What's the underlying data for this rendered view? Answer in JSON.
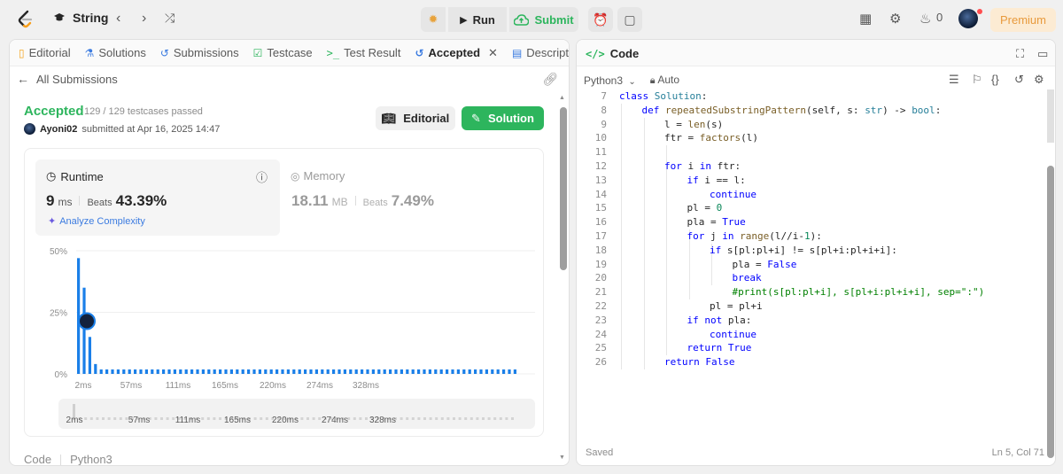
{
  "topbar": {
    "problem_title": "String",
    "run_label": "Run",
    "submit_label": "Submit",
    "streak_count": "0",
    "premium_label": "Premium"
  },
  "left_tabs": [
    {
      "label": "Editorial"
    },
    {
      "label": "Solutions"
    },
    {
      "label": "Submissions"
    },
    {
      "label": "Testcase"
    },
    {
      "label": "Test Result"
    },
    {
      "label": "Accepted"
    },
    {
      "label": "Description"
    }
  ],
  "submission": {
    "back_label": "All Submissions",
    "status": "Accepted",
    "testcases": "129 / 129 testcases passed",
    "user": "Ayoni02",
    "submitted_at": "submitted at Apr 16, 2025 14:47",
    "editorial_button": "Editorial",
    "solution_button": "Solution",
    "runtime_label": "Runtime",
    "runtime_value": "9",
    "runtime_unit": "ms",
    "runtime_beats_label": "Beats",
    "runtime_beats": "43.39%",
    "analyze_label": "Analyze Complexity",
    "memory_label": "Memory",
    "memory_value": "18.11",
    "memory_unit": "MB",
    "memory_beats_label": "Beats",
    "memory_beats": "7.49%",
    "footer_code": "Code",
    "footer_lang": "Python3"
  },
  "chart_data": {
    "type": "bar",
    "x_ticks": [
      "2ms",
      "57ms",
      "111ms",
      "165ms",
      "220ms",
      "274ms",
      "328ms"
    ],
    "y_ticks": [
      "0%",
      "25%",
      "50%"
    ],
    "ylim": [
      0,
      50
    ],
    "bars": [
      47,
      35,
      15,
      4,
      1.8,
      1.8,
      1.8,
      1.8,
      1.8,
      1.8,
      1.8,
      1.8,
      1.8,
      1.8,
      1.8,
      1.8,
      1.8,
      1.8,
      1.8,
      1.8,
      1.8,
      1.8,
      1.8,
      1.8,
      1.8,
      1.8,
      1.8,
      1.8,
      1.8,
      1.8,
      1.8,
      1.8,
      1.8,
      1.8,
      1.8,
      1.8,
      1.8,
      1.8,
      1.8,
      1.8,
      1.8,
      1.8,
      1.8,
      1.8,
      1.8,
      1.8,
      1.8,
      1.8,
      1.8,
      1.8,
      1.8,
      1.8,
      1.8,
      1.8,
      1.8,
      1.8,
      1.8,
      1.8,
      1.8,
      1.8,
      1.8,
      1.8,
      1.8,
      1.8,
      1.8,
      1.8,
      1.8,
      1.8,
      1.8,
      1.8,
      1.8,
      1.8,
      1.8,
      1.8,
      1.8,
      1.8,
      1.8,
      1.8
    ],
    "user_bar_index": 1,
    "bar_color": "#1a7fe8"
  },
  "editor": {
    "title": "Code",
    "language": "Python3",
    "mode": "Auto",
    "status_saved": "Saved",
    "cursor_pos": "Ln 5, Col 71",
    "lines": [
      {
        "n": "7",
        "indent": 0,
        "code": "class Solution:"
      },
      {
        "n": "8",
        "indent": 1,
        "code": "def repeatedSubstringPattern(self, s: str) -> bool:"
      },
      {
        "n": "9",
        "indent": 2,
        "code": "l = len(s)"
      },
      {
        "n": "10",
        "indent": 2,
        "code": "ftr = factors(l)"
      },
      {
        "n": "11",
        "indent": 0,
        "code": ""
      },
      {
        "n": "12",
        "indent": 2,
        "code": "for i in ftr:"
      },
      {
        "n": "13",
        "indent": 3,
        "code": "if i == l:"
      },
      {
        "n": "14",
        "indent": 4,
        "code": "continue"
      },
      {
        "n": "15",
        "indent": 3,
        "code": "pl = 0"
      },
      {
        "n": "16",
        "indent": 3,
        "code": "pla = True"
      },
      {
        "n": "17",
        "indent": 3,
        "code": "for j in range(l//i-1):"
      },
      {
        "n": "18",
        "indent": 4,
        "code": "if s[pl:pl+i] != s[pl+i:pl+i+i]:"
      },
      {
        "n": "19",
        "indent": 5,
        "code": "pla = False"
      },
      {
        "n": "20",
        "indent": 5,
        "code": "break"
      },
      {
        "n": "21",
        "indent": 5,
        "code": "#print(s[pl:pl+i], s[pl+i:pl+i+i], sep=\":\")"
      },
      {
        "n": "22",
        "indent": 4,
        "code": "pl = pl+i"
      },
      {
        "n": "23",
        "indent": 3,
        "code": "if not pla:"
      },
      {
        "n": "24",
        "indent": 4,
        "code": "continue"
      },
      {
        "n": "25",
        "indent": 3,
        "code": "return True"
      },
      {
        "n": "26",
        "indent": 2,
        "code": "return False"
      }
    ]
  }
}
